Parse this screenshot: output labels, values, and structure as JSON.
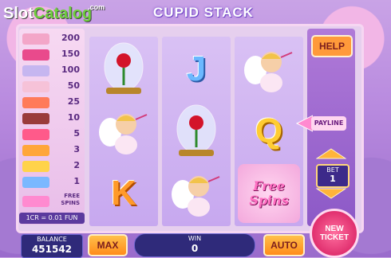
{
  "branding": {
    "logo_slot": "Slot",
    "logo_catalog": "Catalog",
    "logo_com": ".com"
  },
  "game_title": "CUPID STACK",
  "paytable": {
    "rows": [
      {
        "symbol": "cupid-boy-icon",
        "value": "200"
      },
      {
        "symbol": "heart-icon",
        "value": "150"
      },
      {
        "symbol": "rose-dome-icon",
        "value": "100"
      },
      {
        "symbol": "gift-icon",
        "value": "50"
      },
      {
        "symbol": "ribbon-icon",
        "value": "25"
      },
      {
        "symbol": "chocolate-icon",
        "value": "10"
      },
      {
        "symbol": "letter-a-icon",
        "value": "5"
      },
      {
        "symbol": "letter-k-icon",
        "value": "3"
      },
      {
        "symbol": "letter-q-icon",
        "value": "2"
      },
      {
        "symbol": "letter-j-icon",
        "value": "1"
      }
    ],
    "free_spins_label_1": "FREE",
    "free_spins_label_2": "SPINS",
    "coin_note": "1CR = 0.01 FUN"
  },
  "reels": [
    [
      "rose-dome",
      "cupid",
      "K"
    ],
    [
      "J",
      "rose-dome",
      "cupid"
    ],
    [
      "cupid",
      "Q",
      "free-spins"
    ]
  ],
  "reel_letters": {
    "K": "K",
    "J": "J",
    "Q": "Q"
  },
  "free_spins_symbol": {
    "line1": "Free",
    "line2": "Spins"
  },
  "controls": {
    "help_label": "HELP",
    "payline_label": "PAYLINE",
    "bet_label": "BET",
    "bet_value": "1",
    "new_ticket_line1": "NEW",
    "new_ticket_line2": "TICKET",
    "balance_label": "BALANCE",
    "balance_value": "451542",
    "max_label": "MAX",
    "win_label": "WIN",
    "win_value": "0",
    "auto_label": "AUTO"
  },
  "colors": {
    "accent": "#ff9a3a",
    "panel": "#2f2a7a",
    "pink": "#ff6fc2"
  }
}
